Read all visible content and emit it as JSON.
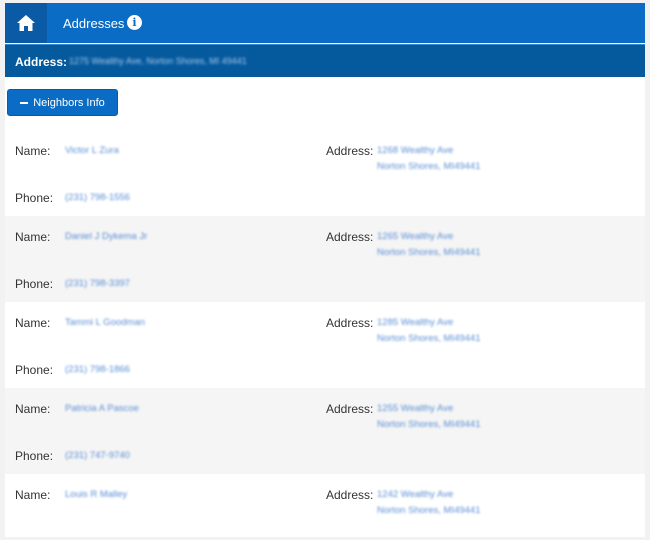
{
  "header": {
    "title": "Addresses",
    "home_icon": "home-icon",
    "info_icon": "info-icon",
    "info_glyph": "i"
  },
  "address_bar": {
    "label": "Address:",
    "value": "1275 Wealthy Ave, Norton Shores, MI 49441"
  },
  "neighbors_button": {
    "label": "Neighbors Info"
  },
  "labels": {
    "name": "Name:",
    "phone": "Phone:",
    "address": "Address:"
  },
  "neighbors": [
    {
      "name": "Victor L Zura",
      "phone": "(231) 798-1556",
      "street": "1268 Wealthy Ave",
      "city": "Norton Shores, MI49441"
    },
    {
      "name": "Daniel J Dykema Jr",
      "phone": "(231) 798-3397",
      "street": "1265 Wealthy Ave",
      "city": "Norton Shores, MI49441"
    },
    {
      "name": "Tammi L Goodman",
      "phone": "(231) 798-1866",
      "street": "1285 Wealthy Ave",
      "city": "Norton Shores, MI49441"
    },
    {
      "name": "Patricia A Pascoe",
      "phone": "(231) 747-9740",
      "street": "1255 Wealthy Ave",
      "city": "Norton Shores, MI49441"
    },
    {
      "name": "Louis R Malley",
      "street": "1242 Wealthy Ave",
      "city": "Norton Shores, MI49441"
    }
  ]
}
